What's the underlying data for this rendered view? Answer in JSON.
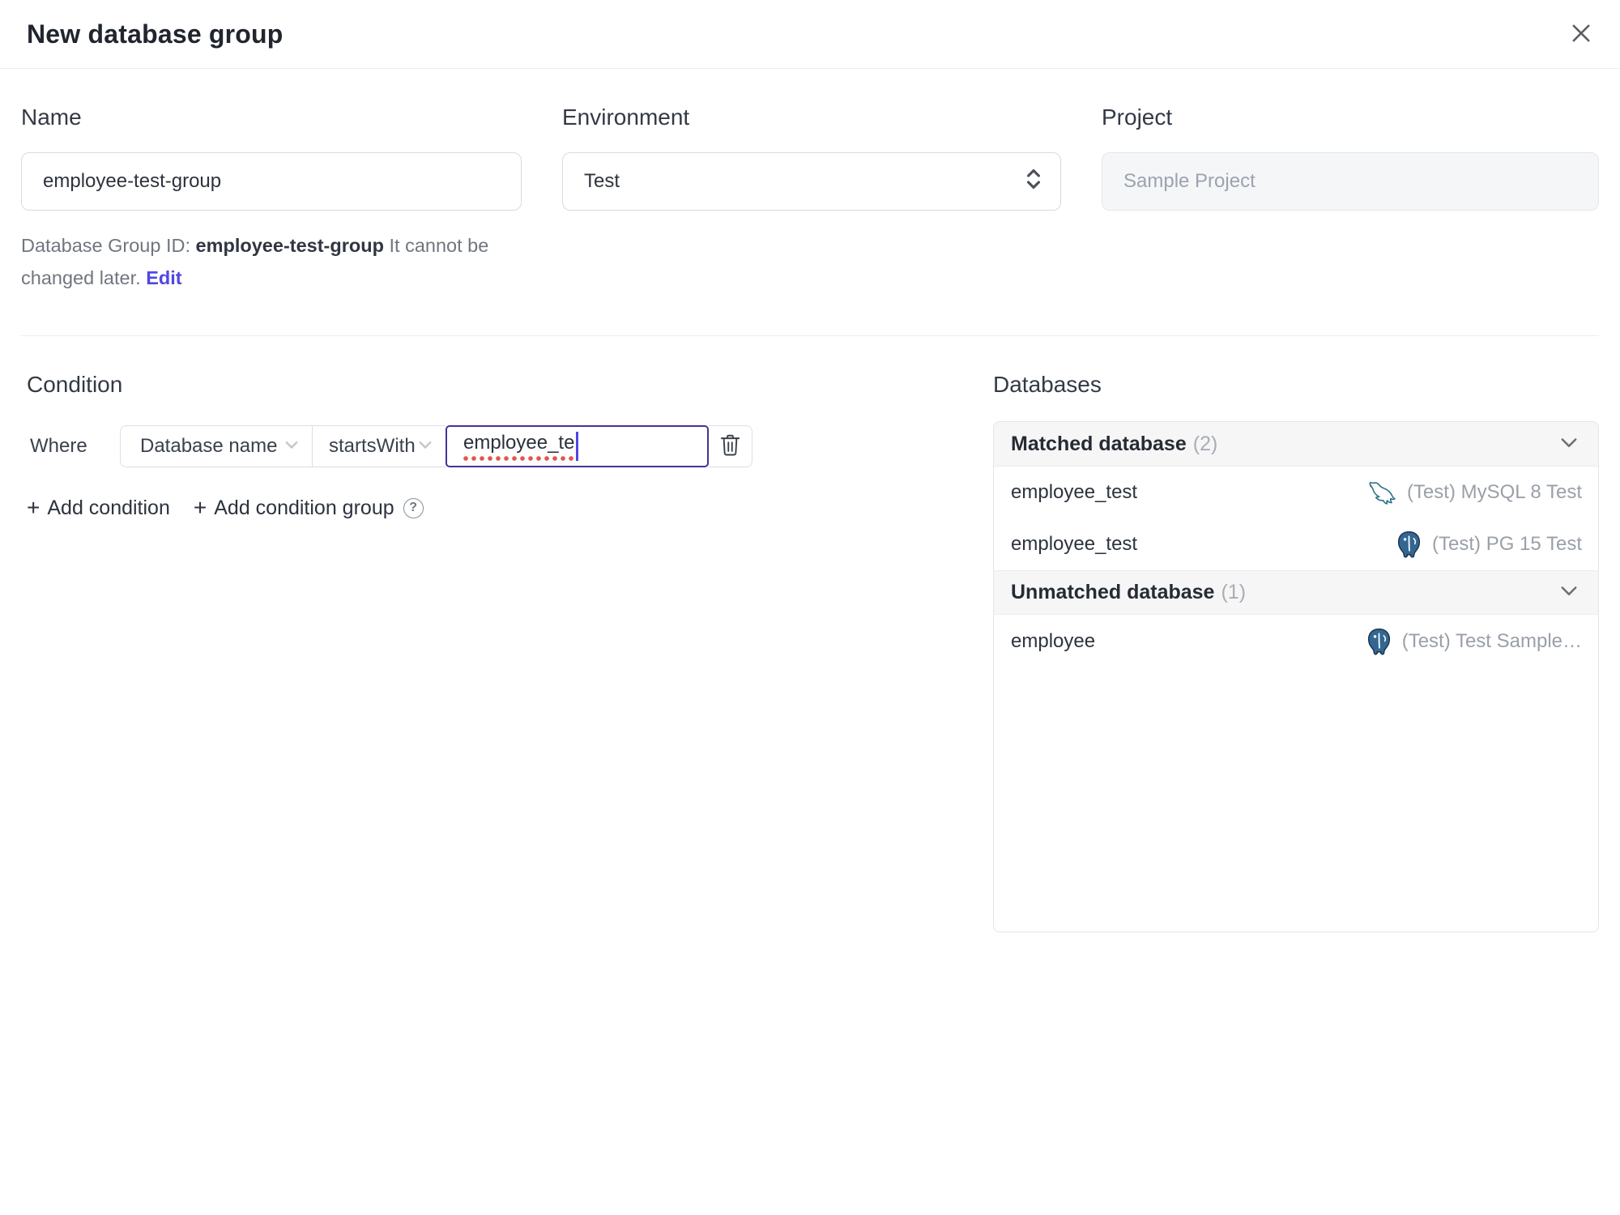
{
  "dialog": {
    "title": "New database group",
    "close_icon": "x"
  },
  "form": {
    "name": {
      "label": "Name",
      "value": "employee-test-group"
    },
    "environment": {
      "label": "Environment",
      "value": "Test"
    },
    "project": {
      "label": "Project",
      "value": "Sample Project"
    },
    "group_id": {
      "prefix": "Database Group ID: ",
      "id": "employee-test-group",
      "note": " It cannot be changed later. ",
      "edit": "Edit"
    }
  },
  "condition": {
    "heading": "Condition",
    "where_label": "Where",
    "field": "Database name",
    "operator": "startsWith",
    "value": "employee_te",
    "plus": "+",
    "add_condition": "Add condition",
    "add_condition_group": "Add condition group",
    "help_glyph": "?"
  },
  "databases": {
    "heading": "Databases",
    "sections": [
      {
        "title": "Matched database",
        "count": "(2)",
        "rows": [
          {
            "name": "employee_test",
            "engine": "mysql",
            "instance": "(Test) MySQL 8 Test"
          },
          {
            "name": "employee_test",
            "engine": "postgres",
            "instance": "(Test) PG 15 Test"
          }
        ]
      },
      {
        "title": "Unmatched database",
        "count": "(1)",
        "rows": [
          {
            "name": "employee",
            "engine": "postgres",
            "instance": "(Test) Test Sample…"
          }
        ]
      }
    ]
  },
  "colors": {
    "accent": "#4f46e5",
    "focus_border": "#3e3695",
    "spellcheck_red": "#e2574c",
    "mysql_teal": "#2e7287",
    "postgres_blue": "#336791",
    "header_bg": "#f6f6f7"
  }
}
